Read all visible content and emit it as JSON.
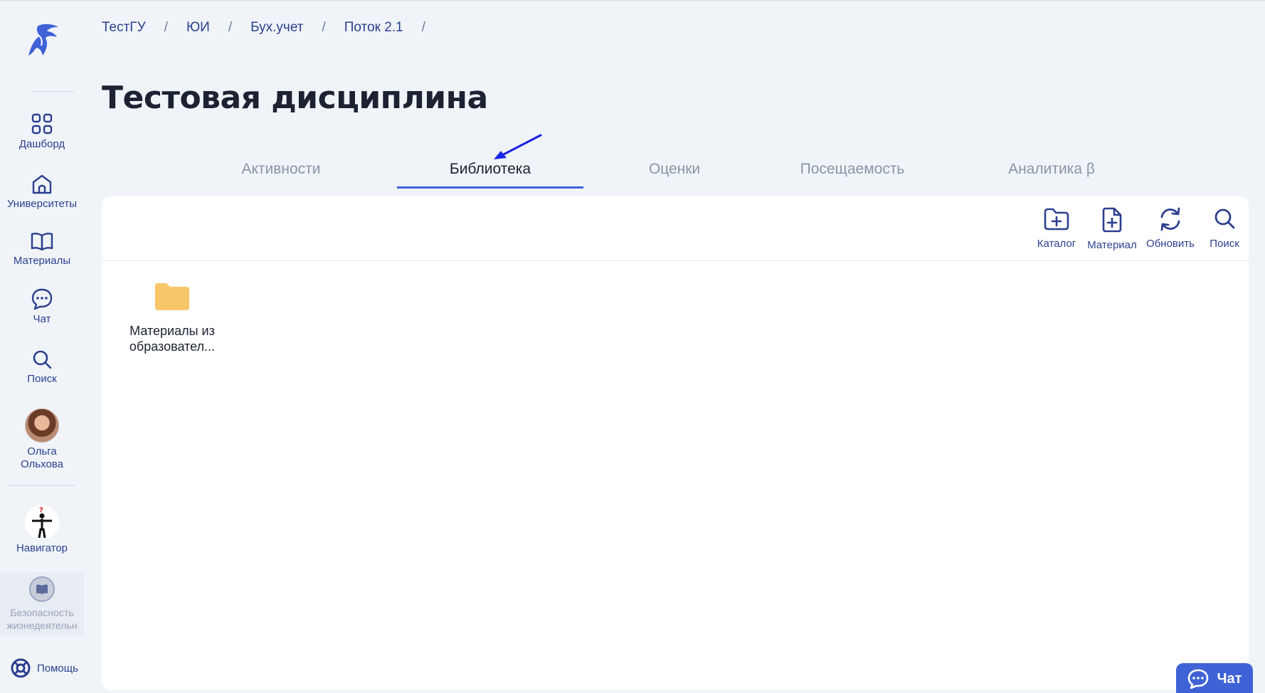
{
  "breadcrumb": [
    "ТестГУ",
    "ЮИ",
    "Бух.учет",
    "Поток 2.1"
  ],
  "page_title": "Тестовая дисциплина",
  "sidebar": {
    "items": [
      {
        "label": "Дашборд",
        "icon": "grid-icon"
      },
      {
        "label": "Университеты",
        "icon": "university-icon"
      },
      {
        "label": "Материалы",
        "icon": "book-icon"
      },
      {
        "label": "Чат",
        "icon": "chat-icon"
      },
      {
        "label": "Поиск",
        "icon": "search-icon"
      },
      {
        "label": "Ольга Ольхова",
        "icon": "avatar"
      }
    ],
    "navigator_label": "Навигатор",
    "course_label": "Безопасность жизнедеятельн",
    "help_label": "Помощь"
  },
  "tabs": [
    {
      "label": "Активности",
      "active": false
    },
    {
      "label": "Библиотека",
      "active": true
    },
    {
      "label": "Оценки",
      "active": false
    },
    {
      "label": "Посещаемость",
      "active": false
    },
    {
      "label": "Аналитика β",
      "active": false
    }
  ],
  "toolbar": {
    "catalog": "Каталог",
    "material": "Материал",
    "refresh": "Обновить",
    "search": "Поиск"
  },
  "folders": [
    {
      "name_line1": "Материалы из",
      "name_line2": "образовател..."
    }
  ],
  "chat_button": "Чат",
  "colors": {
    "accent": "#3f63d6",
    "nav_text": "#2b3f8f",
    "folder": "#f8c66a",
    "background": "#f0f4f8"
  }
}
